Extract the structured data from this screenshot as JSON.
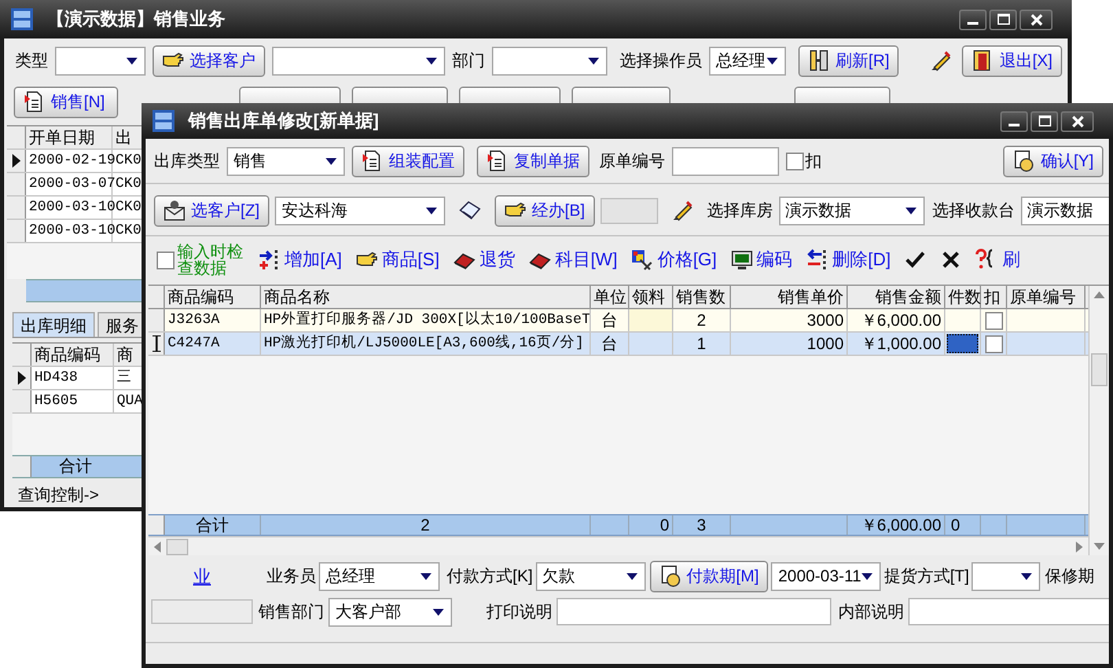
{
  "main_window": {
    "title": "【演示数据】销售业务",
    "filter_bar": {
      "type_label": "类型",
      "customer_button": "选择客户",
      "department_label": "部门",
      "operator_label": "选择操作员",
      "operator_value": "总经理",
      "refresh_button": "刷新[R]",
      "exit_button": "退出[X]"
    },
    "new_sale_button": "销售[N]",
    "orders": {
      "columns": [
        "开单日期",
        "出"
      ],
      "rows": [
        {
          "cells": [
            "2000-02-19",
            "CK0"
          ],
          "current": true
        },
        {
          "cells": [
            "2000-03-07",
            "CK0"
          ],
          "current": false
        },
        {
          "cells": [
            "2000-03-10",
            "CK0"
          ],
          "current": false
        },
        {
          "cells": [
            "2000-03-10",
            "CK0"
          ],
          "current": false
        }
      ]
    },
    "detail_tabs": [
      {
        "label": "出库明细",
        "selected": true
      },
      {
        "label": "服务",
        "selected": false
      }
    ],
    "details": {
      "columns": [
        "商品编码",
        "商"
      ],
      "rows": [
        {
          "cells": [
            "HD438",
            "三"
          ],
          "current": true
        },
        {
          "cells": [
            "H5605",
            "QUA"
          ],
          "current": false
        }
      ],
      "total_label": "合计"
    },
    "query_control": "查询控制->"
  },
  "dialog": {
    "title": "销售出库单修改[新单据]",
    "header_row": {
      "out_type_label": "出库类型",
      "out_type_value": "销售",
      "assemble_button": "组装配置",
      "copy_button": "复制单据",
      "original_no_label": "原单编号",
      "deduct_label": "扣",
      "deduct_checked": false,
      "confirm_button": "确认[Y]"
    },
    "customer_row": {
      "customer_button": "选客户[Z]",
      "customer_value": "安达科海",
      "handler_button": "经办[B]",
      "warehouse_label": "选择库房",
      "warehouse_value": "演示数据",
      "cashier_label": "选择收款台",
      "cashier_value": "演示数据"
    },
    "toolbar": {
      "check_label": "输入时检查数据",
      "check_checked": false,
      "buttons": [
        {
          "kind": "labeled",
          "label": "增加[A]"
        },
        {
          "kind": "labeled",
          "label": "商品[S]"
        },
        {
          "kind": "labeled",
          "label": "退货"
        },
        {
          "kind": "labeled",
          "label": "科目[W]"
        },
        {
          "kind": "labeled",
          "label": "价格[G]"
        },
        {
          "kind": "labeled",
          "label": "编码"
        },
        {
          "kind": "labeled",
          "label": "删除[D]"
        },
        {
          "kind": "icon"
        },
        {
          "kind": "icon"
        },
        {
          "kind": "labeled",
          "label": "刷"
        }
      ]
    },
    "grid": {
      "columns": [
        "商品编码",
        "商品名称",
        "单位",
        "领料",
        "销售数",
        "销售单价",
        "销售金额",
        "件数",
        "扣",
        "原单编号"
      ],
      "rows": [
        {
          "code": "J3263A",
          "name": "HP外置打印服务器/JD 300X[以太10/100BaseT",
          "unit": "台",
          "qty": "2",
          "price": "3000",
          "amount": "￥6,000.00",
          "deduct": false,
          "selected": false
        },
        {
          "code": "C4247A",
          "name": "HP激光打印机/LJ5000LE[A3,600线,16页/分]",
          "unit": "台",
          "qty": "1",
          "price": "1000",
          "amount": "￥1,000.00",
          "deduct": false,
          "selected": true
        }
      ],
      "totals": {
        "label": "合计",
        "name": "2",
        "material": "0",
        "qty": "3",
        "amount": "￥6,000.00",
        "pieces": "0"
      }
    },
    "footer": {
      "link": "业",
      "salesman_label": "业务员",
      "salesman_value": "总经理",
      "payment_label": "付款方式[K]",
      "payment_value": "欠款",
      "payment_term_button": "付款期[M]",
      "date_value": "2000-03-11",
      "pickup_label": "提货方式[T]",
      "warranty_label": "保修期",
      "department_label": "销售部门",
      "department_value": "大客户部",
      "print_note_label": "打印说明",
      "internal_note_label": "内部说明"
    }
  }
}
